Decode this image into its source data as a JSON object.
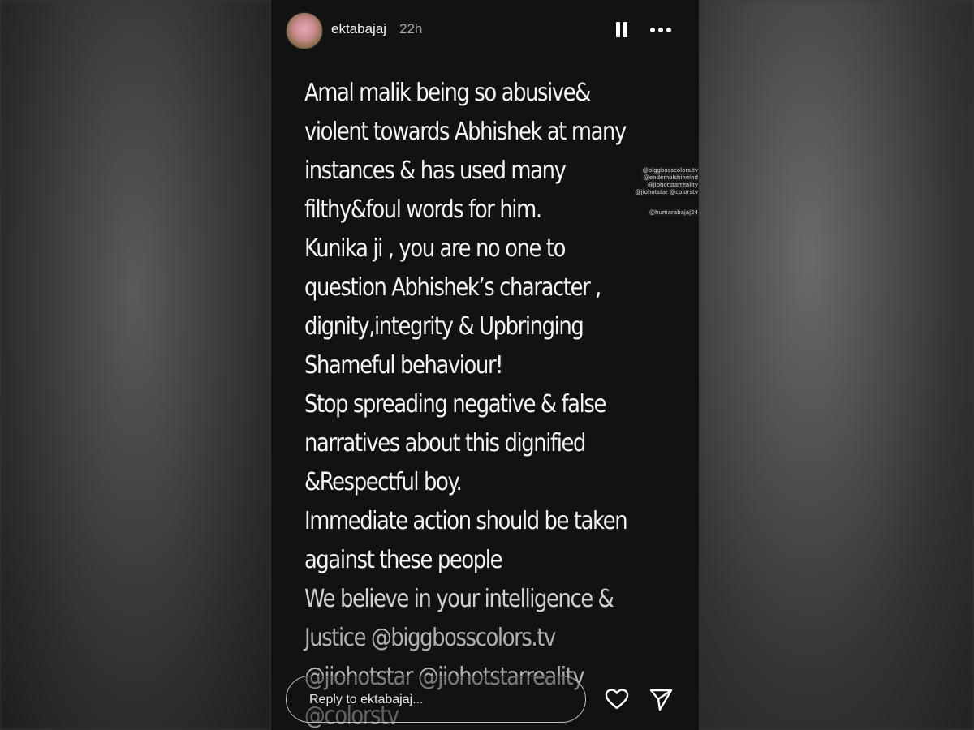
{
  "header": {
    "username": "ektabajaj",
    "timestamp": "22h",
    "pause_icon": "pause-icon",
    "more_icon": "more-options-icon"
  },
  "story": {
    "lines": [
      "Amal malik being so abusive&",
      "violent towards Abhishek at many",
      "instances & has used many",
      "filthy&foul words for him.",
      "Kunika ji , you are no one to",
      "question Abhishek’s character ,",
      "dignity,integrity & Upbringing",
      "Shameful behaviour!",
      "Stop spreading negative & false",
      "narratives about this dignified",
      "&Respectful boy.",
      "Immediate action should be taken",
      "against these people",
      "We believe in your intelligence &",
      "Justice @biggbosscolors.tv",
      "@jiohotstar @jiohotstarreality",
      "@colorstv"
    ],
    "mention_tags": [
      "@biggbosscolors.tv",
      "@endemolshineind",
      "@jiohotstarreality",
      "@jiohotstar @colorstv",
      "@humarabajaj24"
    ]
  },
  "footer": {
    "reply_placeholder": "Reply to ektabajaj...",
    "heart_icon": "heart-icon",
    "send_icon": "send-icon"
  },
  "colors": {
    "story_background": "#121212",
    "text": "#f4f4f4",
    "timestamp": "#a8a8a8"
  }
}
